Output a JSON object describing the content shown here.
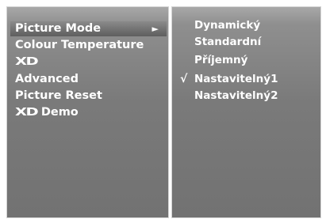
{
  "left_menu": {
    "items": [
      {
        "label": "Picture Mode",
        "type": "text",
        "selected": true,
        "arrow": "►"
      },
      {
        "label": "Colour Temperature",
        "type": "text",
        "selected": false
      },
      {
        "label": "XD",
        "type": "logo",
        "selected": false
      },
      {
        "label": "Advanced",
        "type": "text",
        "selected": false
      },
      {
        "label": "Picture Reset",
        "type": "text",
        "selected": false
      },
      {
        "label": "Demo",
        "logo": "XD",
        "type": "logo-text",
        "selected": false
      }
    ]
  },
  "right_menu": {
    "options": [
      {
        "label": "Dynamický",
        "checked": false
      },
      {
        "label": "Standardní",
        "checked": false
      },
      {
        "label": "Příjemný",
        "checked": false
      },
      {
        "label": "Nastavitelný1",
        "checked": true,
        "mark": "√"
      },
      {
        "label": "Nastavitelný2",
        "checked": false
      }
    ]
  },
  "colors": {
    "panel_top": "#a8a8a8",
    "panel_bottom": "#727272",
    "text": "#ffffff",
    "highlight": "#5e5e5e"
  }
}
